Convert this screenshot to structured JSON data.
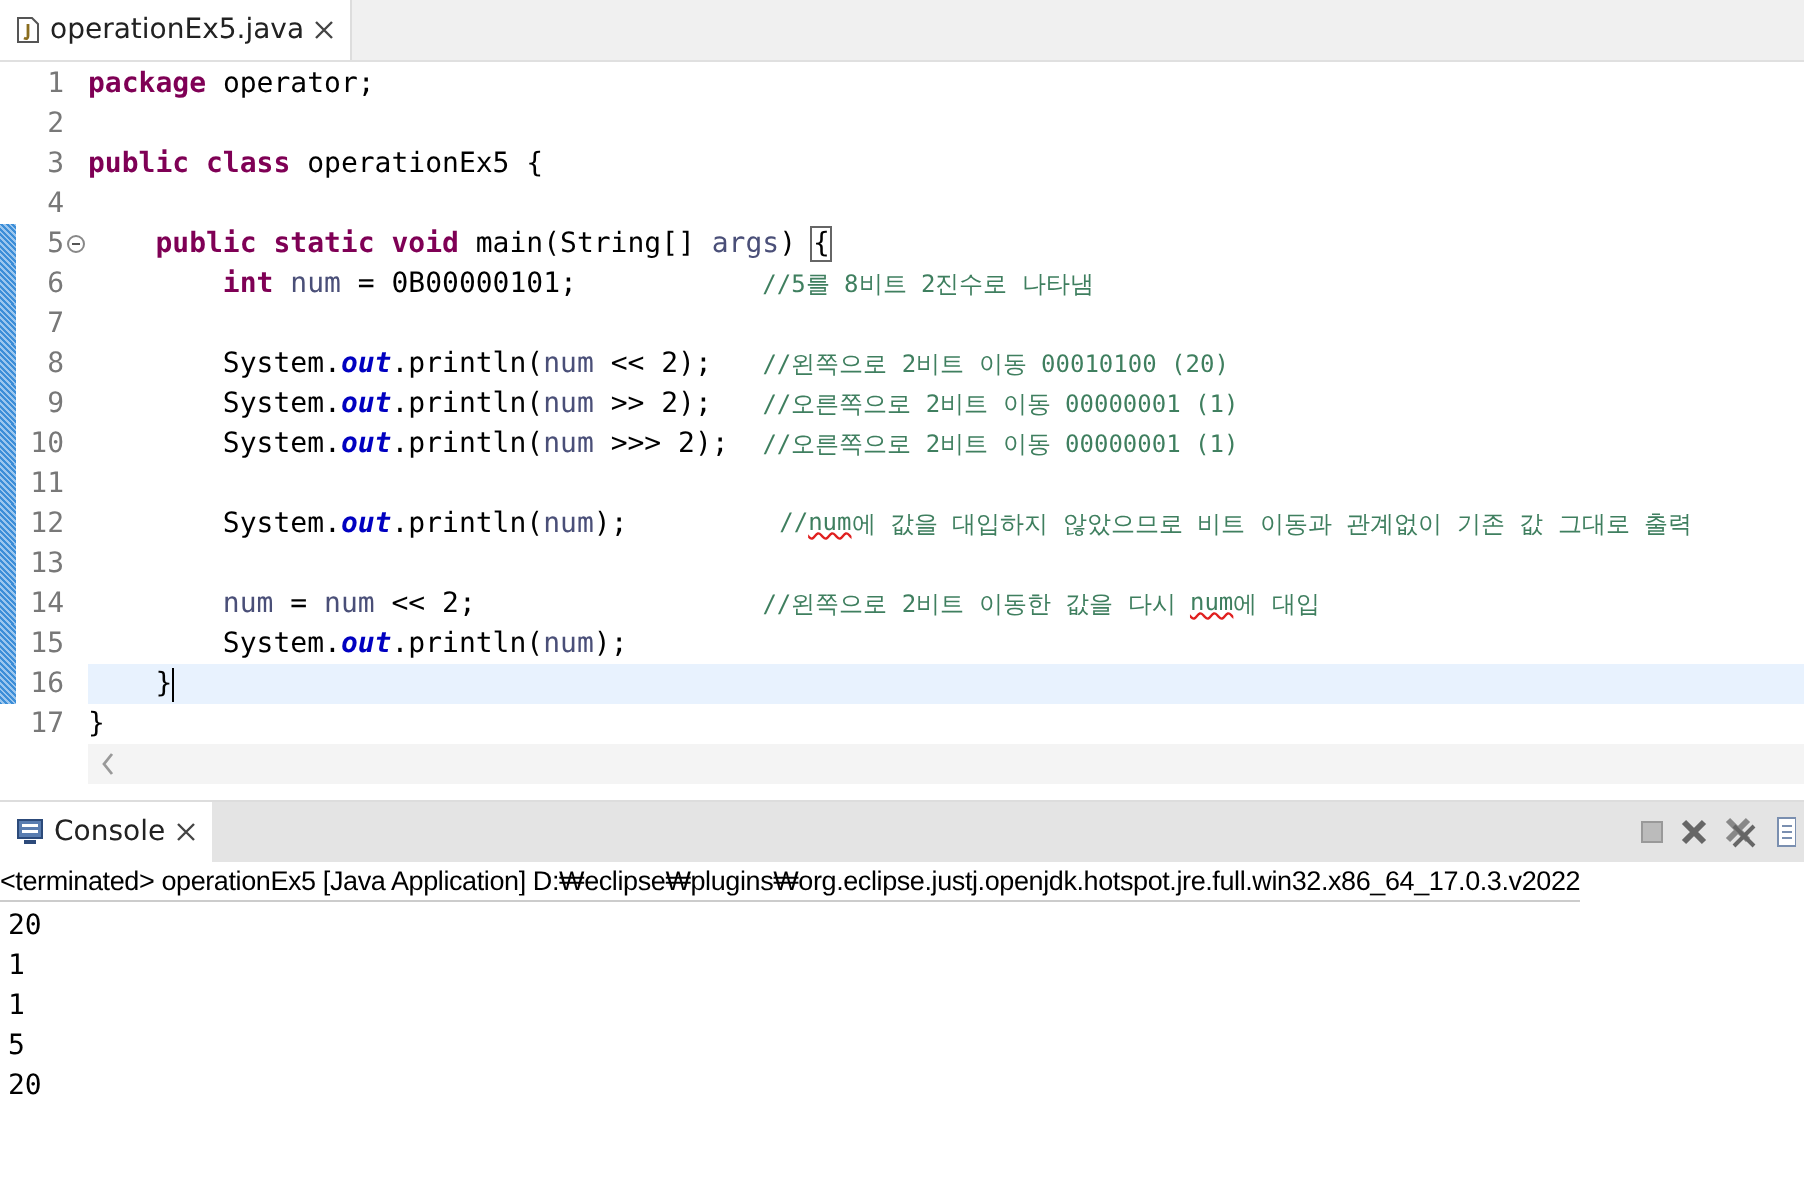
{
  "editor_tab": {
    "label": "operationEx5.java",
    "selected": true
  },
  "lines": [
    {
      "number": "1",
      "changed": false,
      "current": false,
      "fold": false,
      "tokens": [
        {
          "kind": "keyword",
          "text": "package"
        },
        {
          "kind": "plain",
          "text": " operator;"
        }
      ]
    },
    {
      "number": "2",
      "changed": false,
      "current": false,
      "fold": false
    },
    {
      "number": "3",
      "changed": false,
      "current": false,
      "fold": false,
      "tokens": [
        {
          "kind": "keyword",
          "text": "public class"
        },
        {
          "kind": "plain",
          "text": " operationEx5 {"
        }
      ]
    },
    {
      "number": "4",
      "changed": false,
      "current": false,
      "fold": false
    },
    {
      "number": "5",
      "changed": true,
      "current": false,
      "fold": true,
      "tokens": [
        {
          "kind": "keyword",
          "text": "    public static void"
        },
        {
          "kind": "plain",
          "text": " main(String[] "
        },
        {
          "kind": "variable",
          "text": "args"
        },
        {
          "kind": "plain",
          "text": ") "
        },
        {
          "kind": "bracket",
          "text": "{"
        }
      ]
    },
    {
      "number": "6",
      "changed": true,
      "current": false,
      "fold": false,
      "tokens": [
        {
          "kind": "keyword",
          "text": "        int"
        },
        {
          "kind": "variable",
          "text": " num"
        },
        {
          "kind": "plain",
          "text": " = 0B00000101;           "
        },
        {
          "kind": "comment",
          "text": "//5를 8비트 2진수로 나타냄"
        }
      ]
    },
    {
      "number": "7",
      "changed": true,
      "current": false,
      "fold": false
    },
    {
      "number": "8",
      "changed": true,
      "current": false,
      "fold": false,
      "tokens": [
        {
          "kind": "plain",
          "text": "        System."
        },
        {
          "kind": "field",
          "text": "out"
        },
        {
          "kind": "plain",
          "text": ".println("
        },
        {
          "kind": "variable",
          "text": "num"
        },
        {
          "kind": "plain",
          "text": " << 2);   "
        },
        {
          "kind": "comment",
          "text": "//왼쪽으로 2비트 이동 00010100 (20)"
        }
      ]
    },
    {
      "number": "9",
      "changed": true,
      "current": false,
      "fold": false,
      "tokens": [
        {
          "kind": "plain",
          "text": "        System."
        },
        {
          "kind": "field",
          "text": "out"
        },
        {
          "kind": "plain",
          "text": ".println("
        },
        {
          "kind": "variable",
          "text": "num"
        },
        {
          "kind": "plain",
          "text": " >> 2);   "
        },
        {
          "kind": "comment",
          "text": "//오른쪽으로 2비트 이동 00000001 (1)"
        }
      ]
    },
    {
      "number": "10",
      "changed": true,
      "current": false,
      "fold": false,
      "tokens": [
        {
          "kind": "plain",
          "text": "        System."
        },
        {
          "kind": "field",
          "text": "out"
        },
        {
          "kind": "plain",
          "text": ".println("
        },
        {
          "kind": "variable",
          "text": "num"
        },
        {
          "kind": "plain",
          "text": " >>> 2);  "
        },
        {
          "kind": "comment",
          "text": "//오른쪽으로 2비트 이동 00000001 (1)"
        }
      ]
    },
    {
      "number": "11",
      "changed": true,
      "current": false,
      "fold": false
    },
    {
      "number": "12",
      "changed": true,
      "current": false,
      "fold": false,
      "tokens": [
        {
          "kind": "plain",
          "text": "        System."
        },
        {
          "kind": "field",
          "text": "out"
        },
        {
          "kind": "plain",
          "text": ".println("
        },
        {
          "kind": "variable",
          "text": "num"
        },
        {
          "kind": "plain",
          "text": ");         "
        },
        {
          "kind": "comment",
          "text": "//"
        },
        {
          "kind": "comment_spell",
          "text": "num"
        },
        {
          "kind": "comment",
          "text": "에 값을 대입하지 않았으므로 비트 이동과 관계없이 기존 값 그대로 출력"
        }
      ]
    },
    {
      "number": "13",
      "changed": true,
      "current": false,
      "fold": false
    },
    {
      "number": "14",
      "changed": true,
      "current": false,
      "fold": false,
      "tokens": [
        {
          "kind": "variable",
          "text": "        num"
        },
        {
          "kind": "plain",
          "text": " = "
        },
        {
          "kind": "variable",
          "text": "num"
        },
        {
          "kind": "plain",
          "text": " << 2;                 "
        },
        {
          "kind": "comment",
          "text": "//왼쪽으로 2비트 이동한 값을 다시 "
        },
        {
          "kind": "comment_spell",
          "text": "num"
        },
        {
          "kind": "comment",
          "text": "에 대입"
        }
      ]
    },
    {
      "number": "15",
      "changed": true,
      "current": false,
      "fold": false,
      "tokens": [
        {
          "kind": "plain",
          "text": "        System."
        },
        {
          "kind": "field",
          "text": "out"
        },
        {
          "kind": "plain",
          "text": ".println("
        },
        {
          "kind": "variable",
          "text": "num"
        },
        {
          "kind": "plain",
          "text": ");"
        }
      ]
    },
    {
      "number": "16",
      "changed": true,
      "current": true,
      "fold": false,
      "tokens": [
        {
          "kind": "plain",
          "text": "    }"
        }
      ]
    },
    {
      "number": "17",
      "changed": false,
      "current": false,
      "fold": false,
      "tokens": [
        {
          "kind": "plain",
          "text": "}"
        }
      ]
    }
  ],
  "console": {
    "tab": {
      "label": "Console",
      "selected": true
    },
    "status": "<terminated> operationEx5 [Java Application] D:₩eclipse₩plugins₩org.eclipse.justj.openjdk.hotspot.jre.full.win32.x86_64_17.0.3.v2022",
    "output": [
      "20",
      "1",
      "1",
      "5",
      "20"
    ]
  }
}
